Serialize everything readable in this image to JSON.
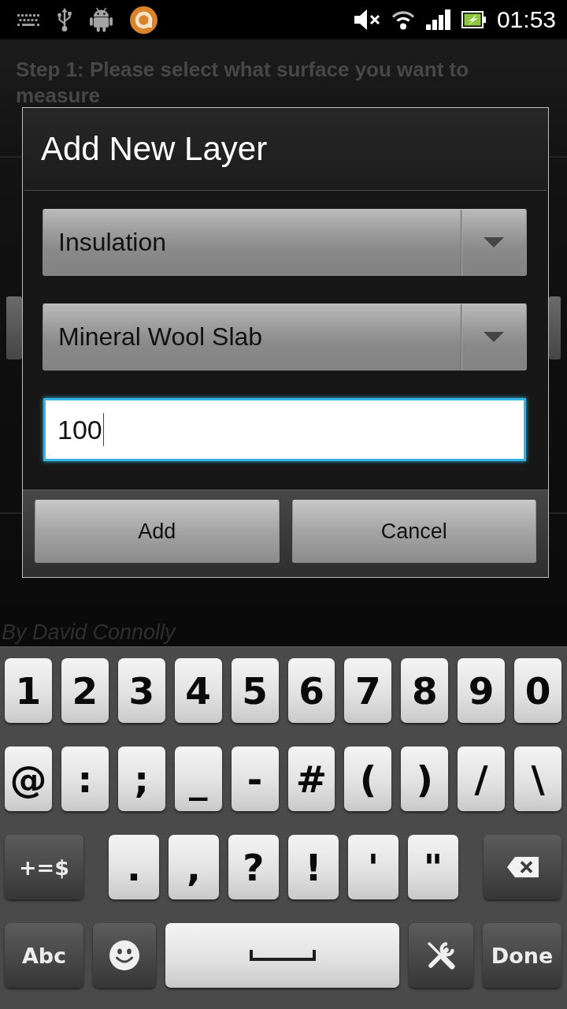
{
  "status_bar": {
    "time": "01:53"
  },
  "screen": {
    "heading": "Step 1: Please select what surface you want to measure",
    "credit": "By David Connolly"
  },
  "dialog": {
    "title": "Add New Layer",
    "dropdowns": [
      {
        "value": "Insulation"
      },
      {
        "value": "Mineral Wool Slab"
      }
    ],
    "input": {
      "value": "100",
      "focused": true
    },
    "buttons": [
      {
        "label": "Add"
      },
      {
        "label": "Cancel"
      }
    ]
  },
  "keyboard": {
    "rows": [
      {
        "keys": [
          {
            "label": "1",
            "kind": "char"
          },
          {
            "label": "2",
            "kind": "char"
          },
          {
            "label": "3",
            "kind": "char"
          },
          {
            "label": "4",
            "kind": "char"
          },
          {
            "label": "5",
            "kind": "char"
          },
          {
            "label": "6",
            "kind": "char"
          },
          {
            "label": "7",
            "kind": "char"
          },
          {
            "label": "8",
            "kind": "char"
          },
          {
            "label": "9",
            "kind": "char"
          },
          {
            "label": "0",
            "kind": "char"
          }
        ]
      },
      {
        "keys": [
          {
            "label": "@",
            "kind": "char"
          },
          {
            "label": ":",
            "kind": "char"
          },
          {
            "label": ";",
            "kind": "char"
          },
          {
            "label": "_",
            "kind": "char"
          },
          {
            "label": "-",
            "kind": "char"
          },
          {
            "label": "#",
            "kind": "char"
          },
          {
            "label": "(",
            "kind": "char"
          },
          {
            "label": ")",
            "kind": "char"
          },
          {
            "label": "/",
            "kind": "char"
          },
          {
            "label": "\\",
            "kind": "char"
          }
        ]
      },
      {
        "keys": [
          {
            "label": "+=$",
            "kind": "function"
          },
          {
            "label": ".",
            "kind": "char"
          },
          {
            "label": ",",
            "kind": "char"
          },
          {
            "label": "?",
            "kind": "char"
          },
          {
            "label": "!",
            "kind": "char"
          },
          {
            "label": "'",
            "kind": "char"
          },
          {
            "label": "\"",
            "kind": "char"
          },
          {
            "kind": "backspace"
          }
        ]
      },
      {
        "keys": [
          {
            "label": "Abc",
            "kind": "function"
          },
          {
            "kind": "emoji"
          },
          {
            "kind": "space"
          },
          {
            "kind": "settings"
          },
          {
            "label": "Done",
            "kind": "function"
          }
        ]
      }
    ]
  }
}
